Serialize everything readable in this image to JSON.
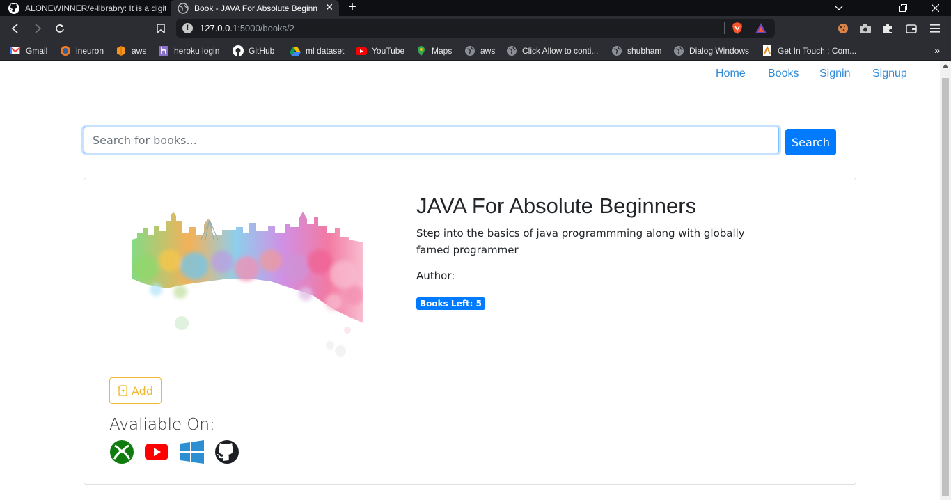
{
  "browser": {
    "tabs": [
      {
        "title": "ALONEWINNER/e-librabry: It is a digit",
        "icon": "github-icon"
      },
      {
        "title": "Book - JAVA For Absolute Beginn",
        "icon": "globe-icon",
        "active": true
      }
    ],
    "address": {
      "host": "127.0.0.1",
      "rest": ":5000/books/2"
    },
    "bookmarks": [
      {
        "label": "Gmail",
        "icon": "gmail-icon"
      },
      {
        "label": "ineuron",
        "icon": "ineuron-icon"
      },
      {
        "label": "aws",
        "icon": "aws-icon"
      },
      {
        "label": "heroku login",
        "icon": "heroku-icon"
      },
      {
        "label": "GitHub",
        "icon": "github-icon"
      },
      {
        "label": "ml dataset",
        "icon": "drive-icon"
      },
      {
        "label": "YouTube",
        "icon": "youtube-icon"
      },
      {
        "label": "Maps",
        "icon": "maps-icon"
      },
      {
        "label": "aws",
        "icon": "globe-icon"
      },
      {
        "label": "Click Allow to conti...",
        "icon": "globe-icon"
      },
      {
        "label": "shubham",
        "icon": "globe-icon"
      },
      {
        "label": "Dialog Windows",
        "icon": "globe-icon"
      },
      {
        "label": "Get In Touch : Com...",
        "icon": "page-icon"
      }
    ]
  },
  "nav": {
    "home": "Home",
    "books": "Books",
    "signin": "Signin",
    "signup": "Signup"
  },
  "search": {
    "placeholder": "Search for books...",
    "button": "Search"
  },
  "book": {
    "title": "JAVA For Absolute Beginners",
    "description": "Step into the basics of java programmming along with globally famed programmer",
    "author": "Author:",
    "badge": "Books Left: 5",
    "add_button": "Add",
    "available_on": "Avaliable On:",
    "platforms": [
      "xbox-icon",
      "youtube-icon",
      "windows-icon",
      "github-icon"
    ]
  },
  "colors": {
    "link": "#2f8ad8",
    "primary": "#007bff",
    "warning": "#f0b72f",
    "chrome_dark": "#0d0f13",
    "chrome_toolbar": "#2b2d33"
  }
}
